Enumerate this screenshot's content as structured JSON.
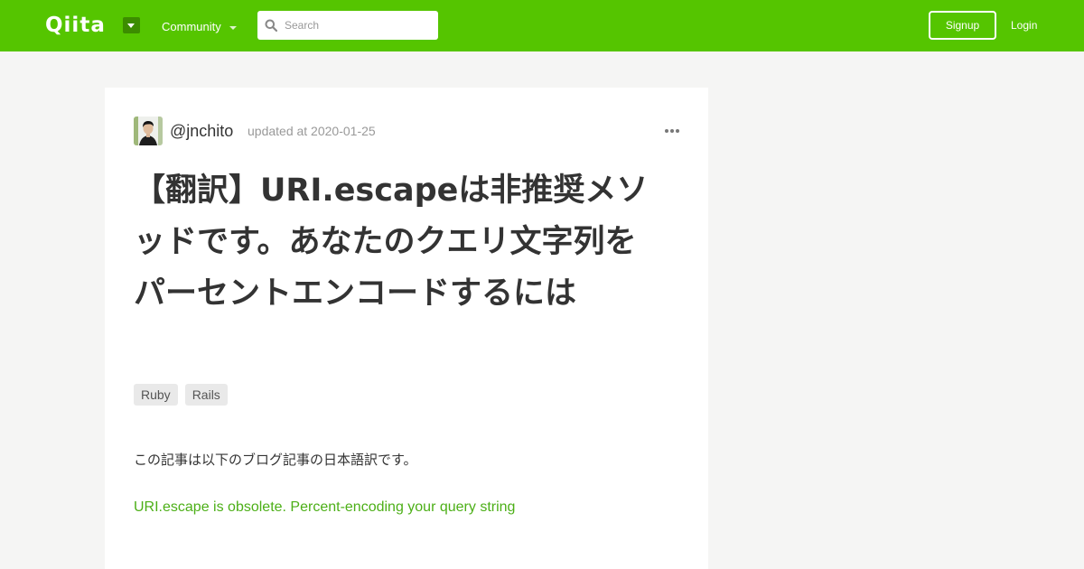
{
  "header": {
    "logo": "Qiita",
    "community_label": "Community",
    "search_placeholder": "Search",
    "signup_label": "Signup",
    "login_label": "Login"
  },
  "article": {
    "author": "@jnchito",
    "updated": "updated at 2020-01-25",
    "title": "【翻訳】URI.escapeは非推奨メソッドです。あなたのクエリ文字列をパーセントエンコードするには",
    "tags": [
      "Ruby",
      "Rails"
    ],
    "intro": "この記事は以下のブログ記事の日本語訳です。",
    "link_text": "URI.escape is obsolete. Percent-encoding your query string"
  },
  "colors": {
    "brand": "#55c500",
    "link": "#4caf17",
    "page_bg": "#f5f5f4"
  },
  "icons": [
    "dropdown-caret-icon",
    "chevron-down-icon",
    "search-icon",
    "more-icon"
  ]
}
